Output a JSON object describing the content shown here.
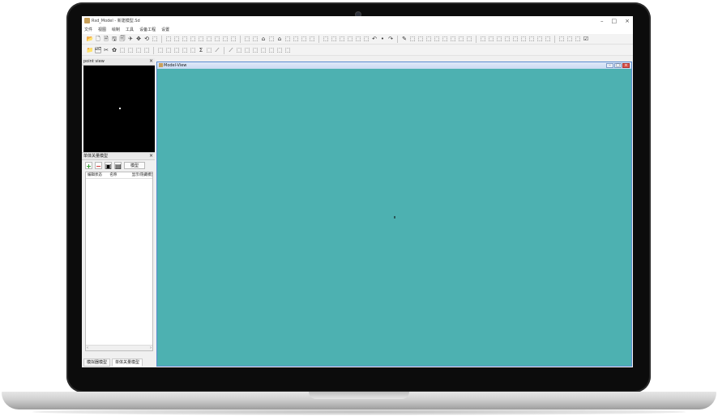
{
  "window": {
    "title": "Rsd_Model - 新建模型.Sd",
    "controls": [
      "–",
      "□",
      "×"
    ]
  },
  "menu": [
    "文件",
    "视图",
    "绘制",
    "工具",
    "设备工程",
    "设置"
  ],
  "toolbar1_icons": [
    "📂",
    "🗋",
    "🗎",
    "🖫",
    "🗐",
    "✈",
    "✥",
    "⟲",
    "⬚",
    "⬚",
    "⬚",
    "⬚",
    "⬚",
    "⬚",
    "⬚",
    "⬚",
    "⬚",
    "⬚",
    "⬚",
    "⬚",
    "⌂",
    "⬚",
    "⌂",
    "⬚",
    "⬚",
    "⬚",
    "⬚",
    "⬚",
    "⬚",
    "⬚",
    "⬚",
    "⬚",
    "⬚",
    "↶",
    "•",
    "↷",
    "✎",
    "⬚",
    "⬚",
    "⬚",
    "⬚",
    "⬚",
    "⬚",
    "⬚",
    "⬚",
    "⬚",
    "⬚",
    "⬚",
    "⬚",
    "⬚",
    "⬚",
    "⬚",
    "⬚",
    "⬚",
    "⬚",
    "⬚",
    "⬚",
    "☑"
  ],
  "toolbar2_icons": [
    "📁",
    "🗂",
    "✂",
    "✿",
    "⬚",
    "⬚",
    "⬚",
    "⬚",
    "⬚",
    "⬚",
    "⬚",
    "⬚",
    "⬚",
    "Σ",
    "⬚",
    "⟋",
    "⟋",
    "⬚",
    "⬚",
    "⬚",
    "⬚",
    "⬚",
    "⬚",
    "⬚"
  ],
  "point_view": {
    "title": "point view",
    "close": "×"
  },
  "model_manager": {
    "title": "单体关量模型",
    "close": "×",
    "add": "+",
    "remove": "−",
    "model_button": "模型",
    "columns": [
      "编辑状态",
      "名称",
      "显示/隐藏模型"
    ],
    "scroll_left": "‹",
    "scroll_right": "›"
  },
  "bottom_tabs": [
    "模拟器模型",
    "单体关量模型"
  ],
  "model_view": {
    "title": "Model-View",
    "buttons": [
      "–",
      "□",
      "×"
    ]
  },
  "colors": {
    "viewport": "#4db1b1",
    "titlebar_accent": "#5a8bd0"
  }
}
